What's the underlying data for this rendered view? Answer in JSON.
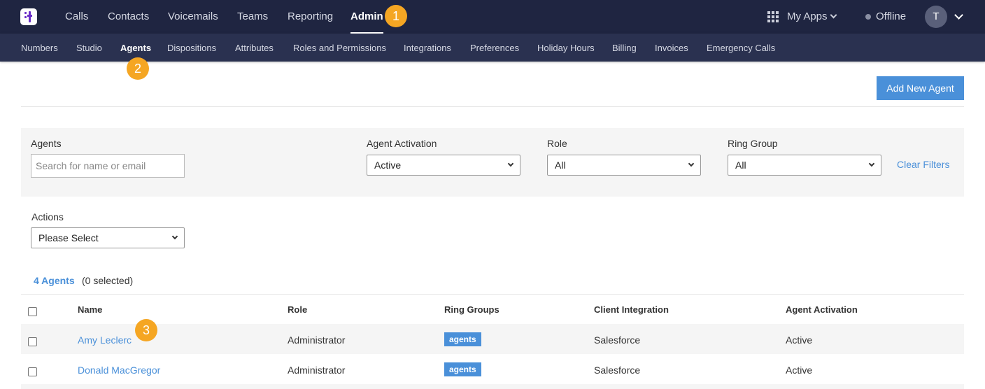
{
  "topnav": {
    "items": [
      "Calls",
      "Contacts",
      "Voicemails",
      "Teams",
      "Reporting",
      "Admin"
    ],
    "active": "Admin",
    "my_apps": "My Apps",
    "status": "Offline",
    "avatar_initial": "T"
  },
  "subnav": {
    "items": [
      "Numbers",
      "Studio",
      "Agents",
      "Dispositions",
      "Attributes",
      "Roles and Permissions",
      "Integrations",
      "Preferences",
      "Holiday Hours",
      "Billing",
      "Invoices",
      "Emergency Calls"
    ],
    "active": "Agents"
  },
  "badges": [
    "1",
    "2",
    "3"
  ],
  "toolbar": {
    "add_agent_label": "Add New Agent"
  },
  "filters": {
    "agents_label": "Agents",
    "agents_placeholder": "Search for name or email",
    "activation_label": "Agent Activation",
    "activation_value": "Active",
    "role_label": "Role",
    "role_value": "All",
    "ring_group_label": "Ring Group",
    "ring_group_value": "All",
    "clear_label": "Clear Filters"
  },
  "actions": {
    "label": "Actions",
    "value": "Please Select"
  },
  "summary": {
    "count": "4 Agents",
    "selected": "(0 selected)"
  },
  "table": {
    "columns": [
      "Name",
      "Role",
      "Ring Groups",
      "Client Integration",
      "Agent Activation"
    ],
    "rows": [
      {
        "name": "Amy Leclerc",
        "role": "Administrator",
        "ring_group": "agents",
        "integration": "Salesforce",
        "activation": "Active"
      },
      {
        "name": "Donald MacGregor",
        "role": "Administrator",
        "ring_group": "agents",
        "integration": "Salesforce",
        "activation": "Active"
      }
    ]
  },
  "colors": {
    "topnav_bg": "#1f2541",
    "subnav_bg": "#2a3150",
    "accent": "#4a90d9",
    "badge": "#f5a623"
  }
}
